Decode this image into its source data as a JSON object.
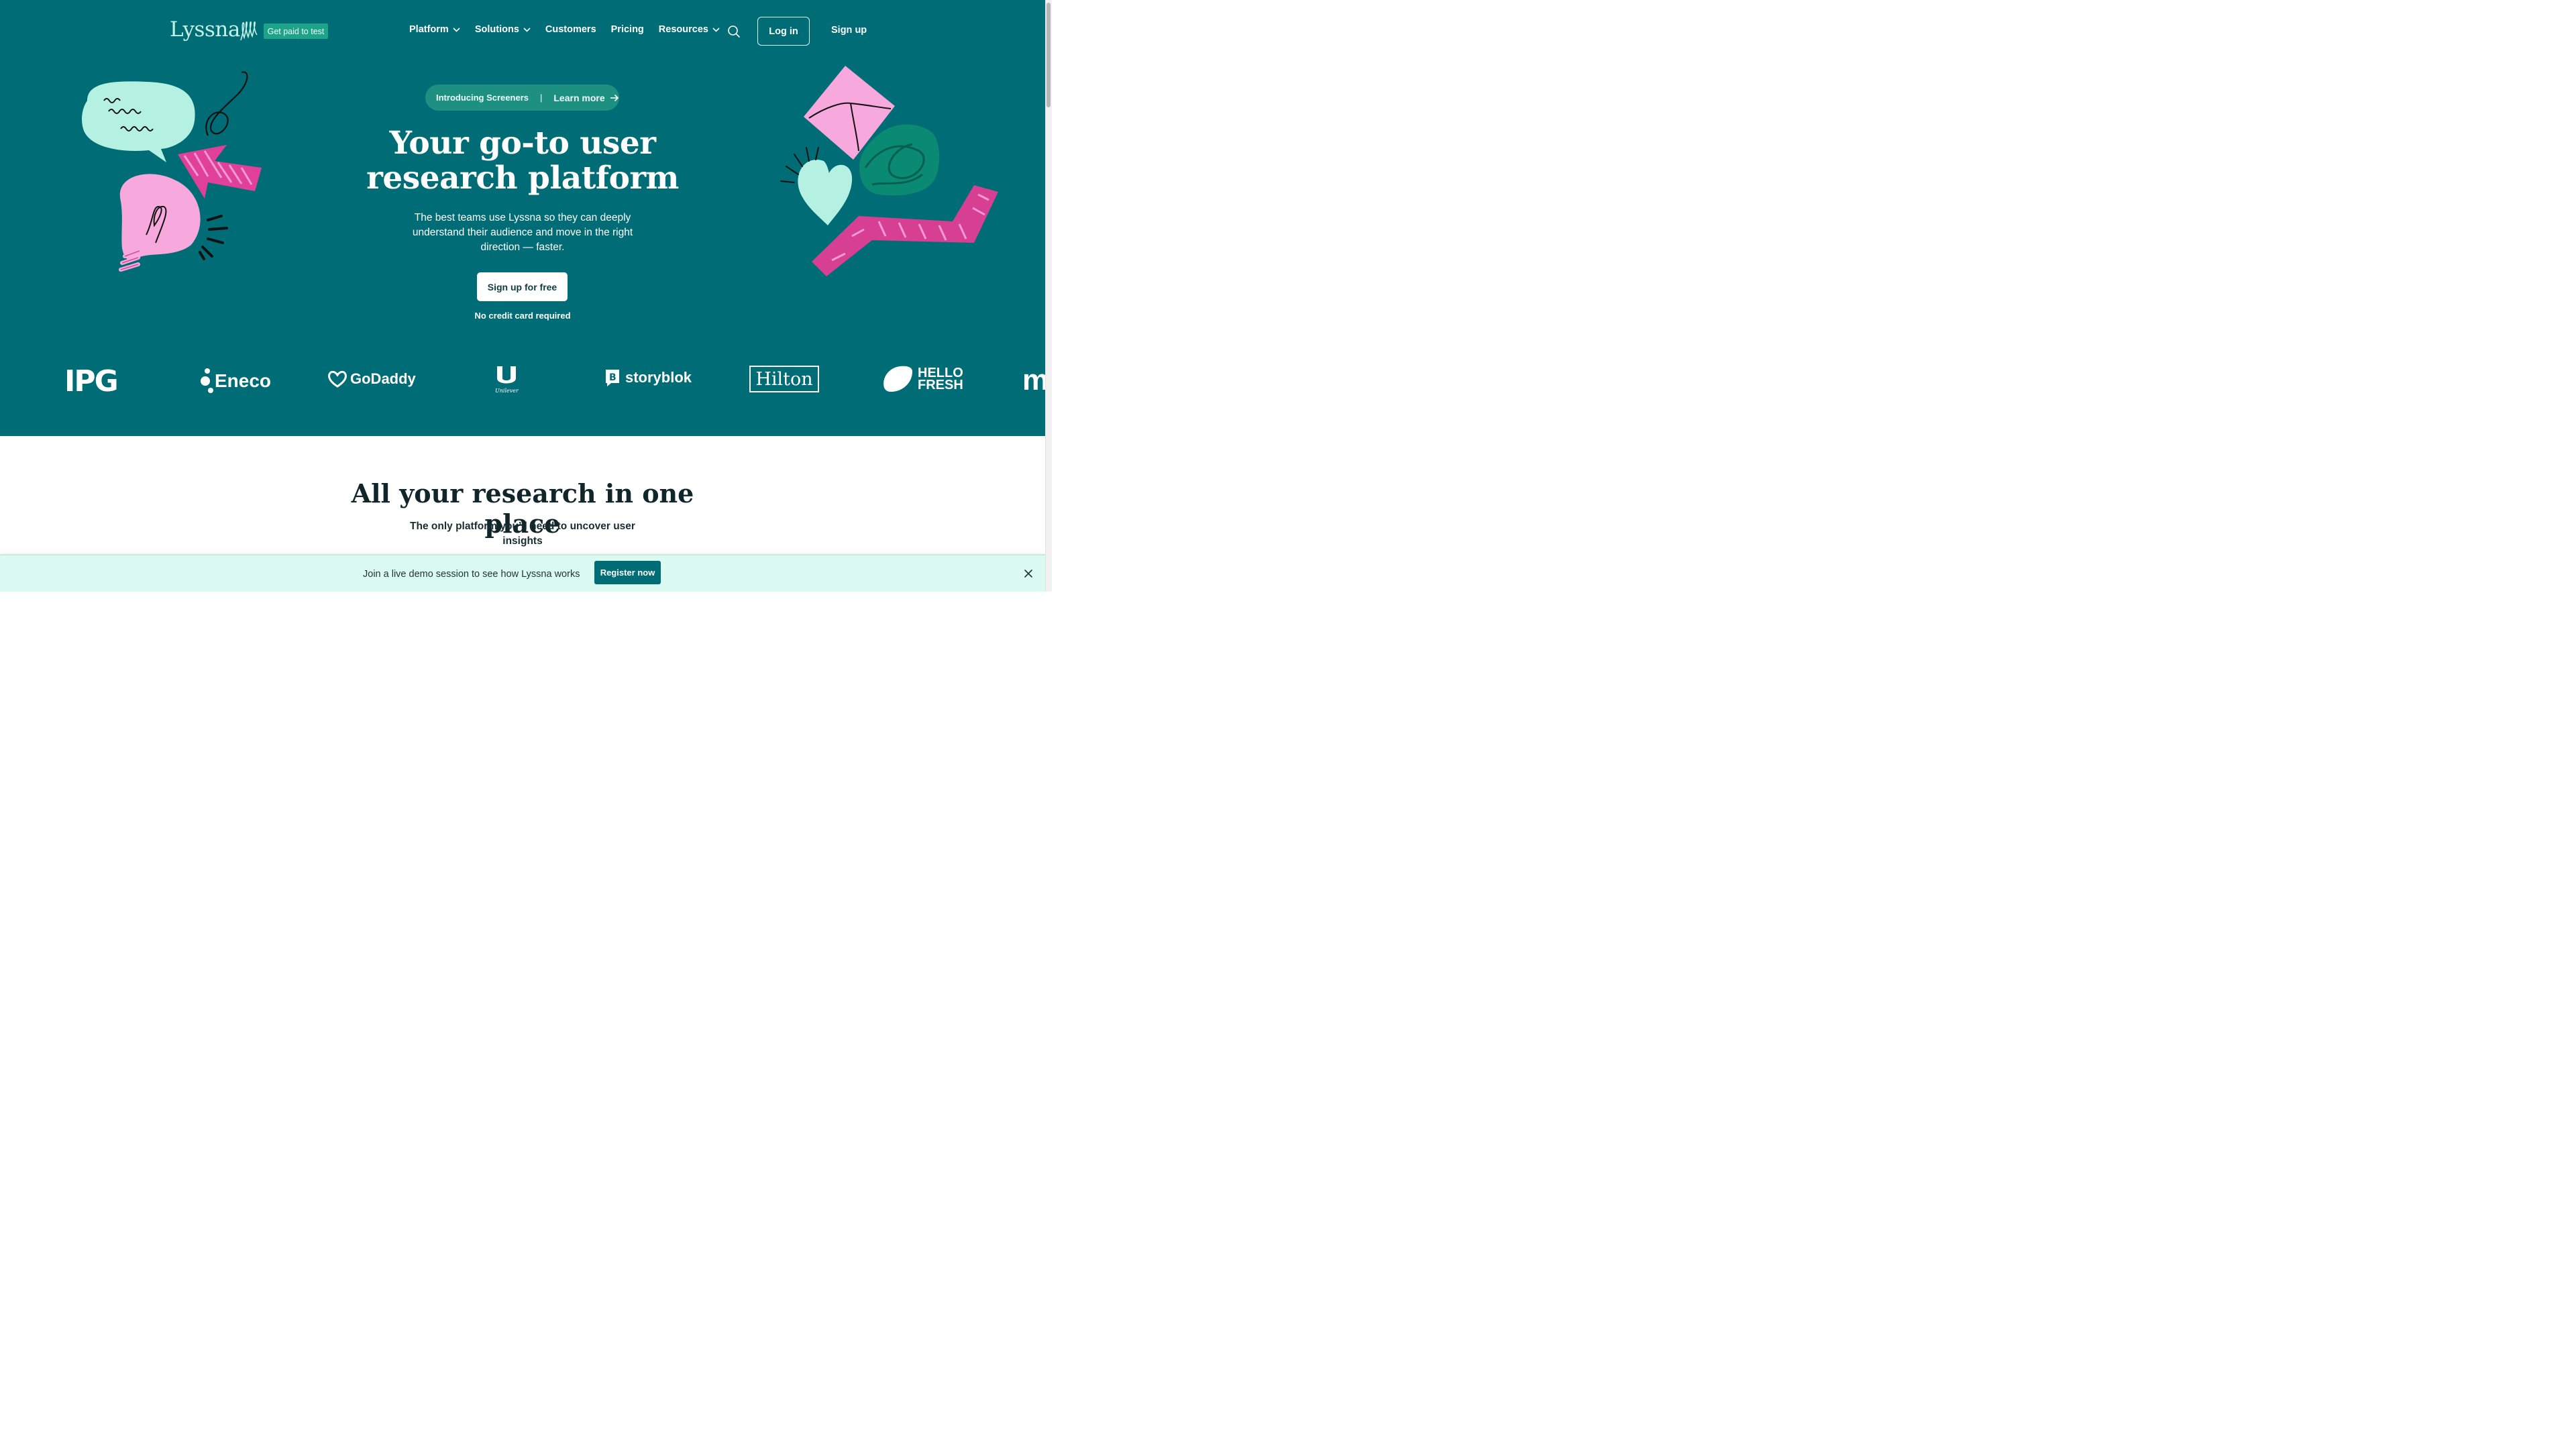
{
  "header": {
    "logo_text": "Lyssna",
    "badge": "Get paid to test",
    "nav": [
      {
        "label": "Platform",
        "dropdown": true
      },
      {
        "label": "Solutions",
        "dropdown": true
      },
      {
        "label": "Customers",
        "dropdown": false
      },
      {
        "label": "Pricing",
        "dropdown": false
      },
      {
        "label": "Resources",
        "dropdown": true
      }
    ],
    "search_icon": "search-icon",
    "login": "Log in",
    "signup": "Sign up"
  },
  "hero": {
    "announce_left": "Introducing Screeners",
    "announce_sep": "|",
    "announce_link": "Learn more",
    "headline_1": "Your go-to user",
    "headline_2": "research platform",
    "subtext": "The best teams use Lyssna so they can deeply understand their audience and move in the right direction — faster.",
    "cta": "Sign up for free",
    "cta_note": "No credit card required"
  },
  "logos": {
    "items": [
      "IPG",
      "Eneco",
      "GoDaddy",
      "Unilever",
      "storyblok",
      "Hilton",
      "HELLO",
      "FRESH",
      "m"
    ]
  },
  "section": {
    "title": "All your research in one place",
    "subtitle": "The only platform you’ll need to uncover user insights"
  },
  "banner": {
    "text": "Join a live demo session to see how Lyssna works",
    "button": "Register now",
    "close_icon": "close-icon"
  },
  "colors": {
    "brand": "#006c75",
    "mint": "#b4f1e2",
    "pink": "#f7a8dc",
    "magenta": "#d63f92",
    "teal_dark": "#0a8a72"
  }
}
